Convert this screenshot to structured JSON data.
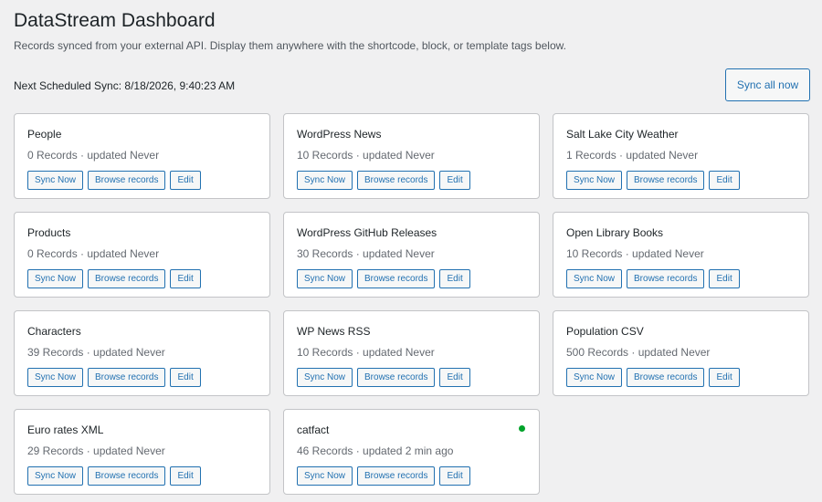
{
  "header": {
    "title": "DataStream Dashboard",
    "description": "Records synced from your external API. Display them anywhere with the shortcode, block, or template tags below.",
    "next_sync": "Next Scheduled Sync: 8/18/2026, 9:40:23 AM",
    "sync_all_label": "Sync all now"
  },
  "buttons": {
    "sync": "Sync Now",
    "browse": "Browse records",
    "edit": "Edit"
  },
  "colors": {
    "accent": "#2271b1",
    "status_ok": "#00a32a",
    "background": "#f0f0f1"
  },
  "cards": [
    {
      "title": "People",
      "meta": "0 Records · updated Never",
      "active": false
    },
    {
      "title": "WordPress News",
      "meta": "10 Records · updated Never",
      "active": false
    },
    {
      "title": "Salt Lake City Weather",
      "meta": "1 Records · updated Never",
      "active": false
    },
    {
      "title": "Products",
      "meta": "0 Records · updated Never",
      "active": false
    },
    {
      "title": "WordPress GitHub Releases",
      "meta": "30 Records · updated Never",
      "active": false
    },
    {
      "title": "Open Library Books",
      "meta": "10 Records · updated Never",
      "active": false
    },
    {
      "title": "Characters",
      "meta": "39 Records · updated Never",
      "active": false
    },
    {
      "title": "WP News RSS",
      "meta": "10 Records · updated Never",
      "active": false
    },
    {
      "title": "Population CSV",
      "meta": "500 Records · updated Never",
      "active": false
    },
    {
      "title": "Euro rates XML",
      "meta": "29 Records · updated Never",
      "active": false
    },
    {
      "title": "catfact",
      "meta": "46 Records · updated 2 min ago",
      "active": true
    }
  ]
}
